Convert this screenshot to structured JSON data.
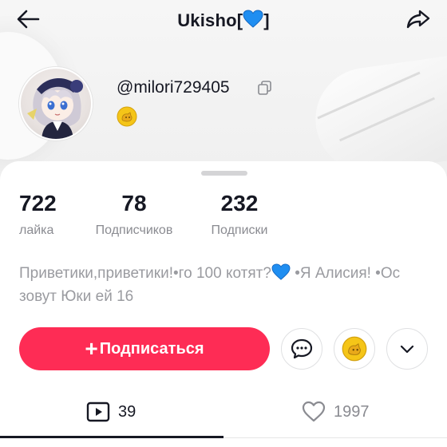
{
  "header": {
    "title": "Ukisho[",
    "title_suffix": "]",
    "title_emoji": "blue-heart-icon"
  },
  "profile": {
    "username": "@milori729405",
    "badge": "yellow-badge-icon"
  },
  "stats": [
    {
      "value": "722",
      "label": "лайка"
    },
    {
      "value": "78",
      "label": "Подписчиков"
    },
    {
      "value": "232",
      "label": "Подписки"
    }
  ],
  "bio": {
    "part1": "Приветики,приветики!•го 100 котят?",
    "part2": "•Я Алисия! •Ос зовут Юки ей 16"
  },
  "actions": {
    "follow_plus": "+",
    "follow_label": "Подписаться",
    "buttons": [
      "message-icon",
      "yellow-badge-icon",
      "chevron-down-icon"
    ]
  },
  "tabs": {
    "videos_count": "39",
    "likes_count": "1997"
  },
  "colors": {
    "accent": "#fe2c55",
    "heart": "#1f8ef1",
    "badge": "#f5c518"
  }
}
